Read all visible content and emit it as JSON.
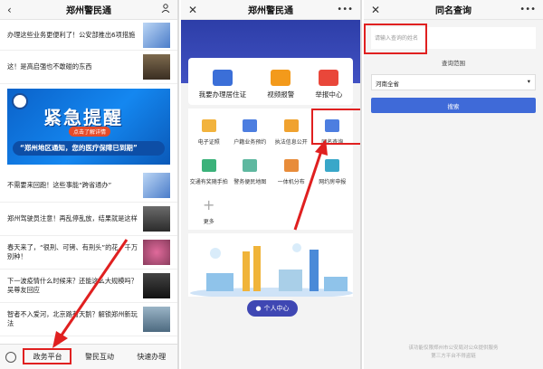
{
  "panel1": {
    "title": "郑州警民通",
    "news": [
      {
        "text": "办理这些业务更便利了！公安部推出6项措施"
      },
      {
        "text": "这！是高启强也不敢碰的东西"
      },
      {
        "text": "不需要来回跑！这些事能“跨省通办”"
      },
      {
        "text": "郑州驾驶员注意！再乱停乱放，结果就是这样"
      },
      {
        "text": "春天来了，“很刑、可铐、有刑头”的花，千万别种！"
      },
      {
        "text": "下一波疫情什么时候来？还能这么大规模吗？吴尊友回应"
      },
      {
        "text": "智者不入爱河，北京路有天鹅？解锁郑州新玩法"
      }
    ],
    "banner": {
      "big": "紧急提醒",
      "tag": "点击了解详情",
      "sub": "“郑州地区通知，您的医疗保障已到期”"
    },
    "tabs": [
      "政务平台",
      "警民互动",
      "快速办理"
    ]
  },
  "panel2": {
    "title": "郑州警民通",
    "cards": [
      "我要办理居住证",
      "视频报警",
      "举报中心"
    ],
    "grid": [
      "电子证照",
      "户籍业务预约",
      "执法信息公开",
      "同名查询",
      "交通有奖随手拍",
      "警务便民地图",
      "一体机分布",
      "网约房申报",
      "更多"
    ],
    "person": "个人中心"
  },
  "panel3": {
    "title": "同名查询",
    "placeholder": "请输入查询的姓名",
    "range_label": "查询范围",
    "select_value": "河南全省",
    "search_label": "搜索",
    "footer1": "该功能仅限郑州市公安局对公众提供服务",
    "footer2": "第三方平台不得盗链"
  },
  "colors": {
    "accent": "#3f47b3",
    "alert": "#e02020"
  }
}
